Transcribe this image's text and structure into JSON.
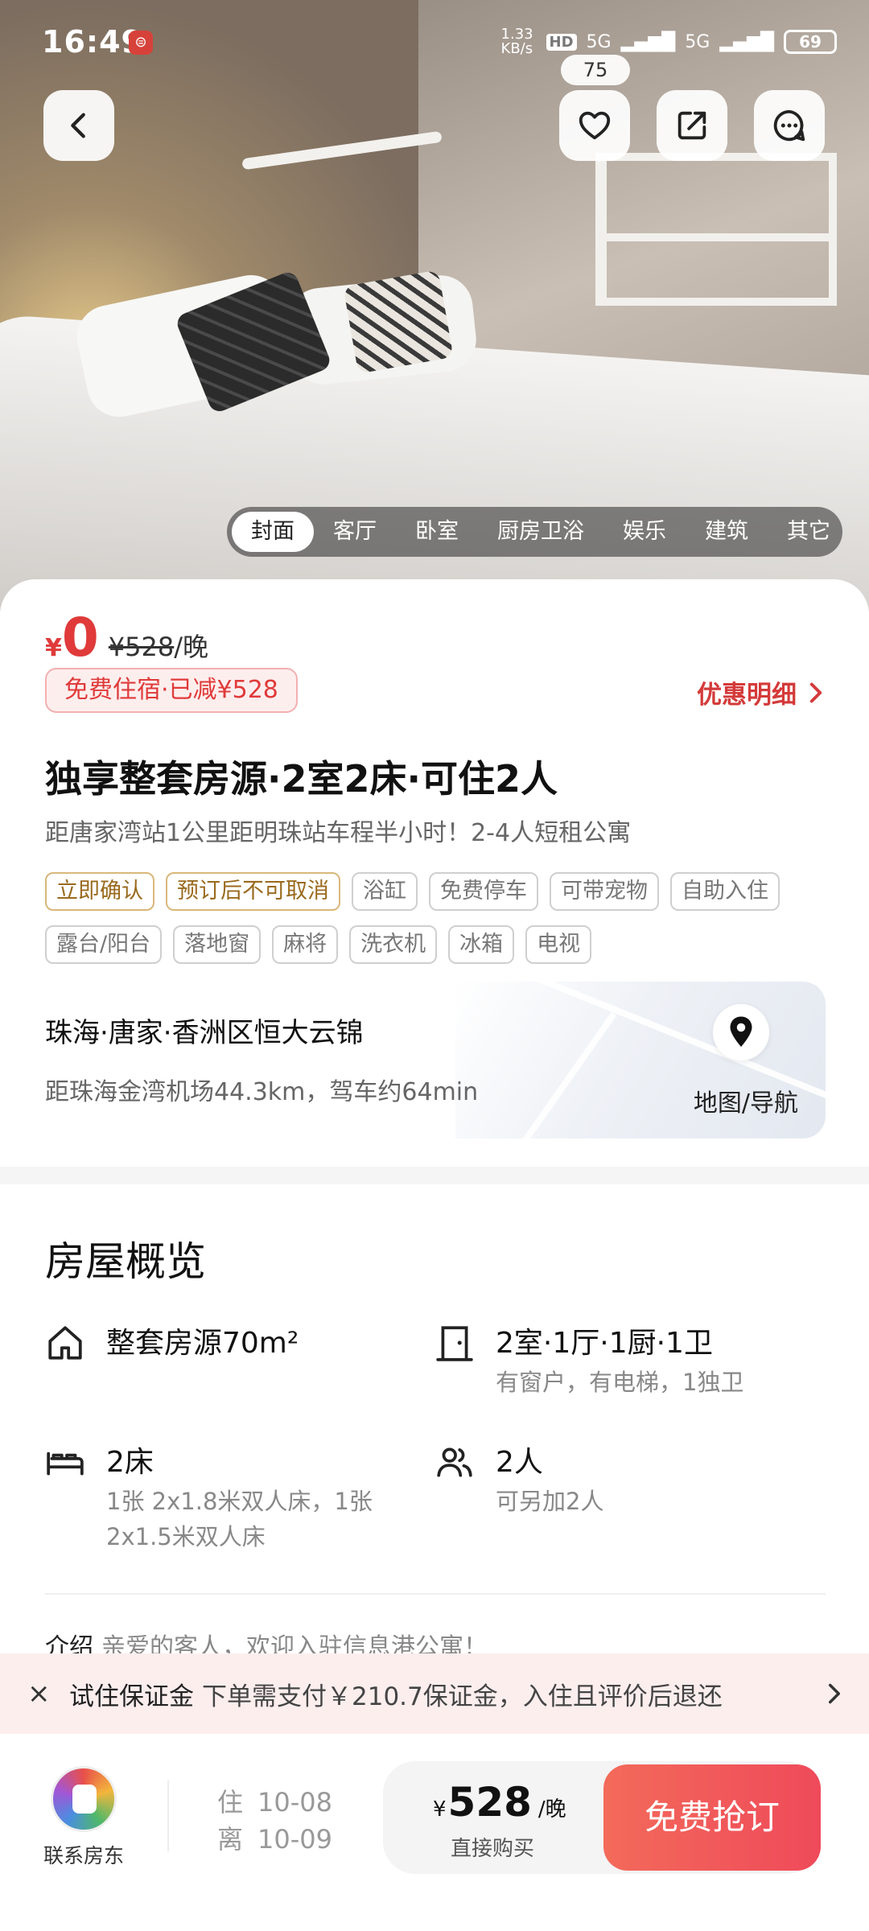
{
  "status_bar": {
    "time": "16:49",
    "net_speed": "1.33 KB/s",
    "hd": "HD",
    "signal1": "5G",
    "signal2": "5G",
    "battery": "69"
  },
  "header": {
    "favorite_count": "75",
    "icons": [
      "back-icon",
      "heart-icon",
      "share-icon",
      "message-icon"
    ]
  },
  "photo_tabs": [
    "封面",
    "客厅",
    "卧室",
    "厨房卫浴",
    "娱乐",
    "建筑",
    "其它"
  ],
  "photo_tab_active": 0,
  "price": {
    "currency": "¥",
    "current": "0",
    "original": "¥528",
    "per_night": "/晚",
    "promo": "免费住宿·已减¥528",
    "detail_link": "优惠明细"
  },
  "listing": {
    "title": "独享整套房源·2室2床·可住2人",
    "subtitle": "距唐家湾站1公里距明珠站车程半小时！2-4人短租公寓",
    "tags_highlight": [
      "立即确认",
      "预订后不可取消"
    ],
    "tags": [
      "浴缸",
      "免费停车",
      "可带宠物",
      "自助入住",
      "露台/阳台",
      "落地窗",
      "麻将",
      "洗衣机",
      "冰箱",
      "电视"
    ]
  },
  "location": {
    "name": "珠海·唐家·香洲区恒大云锦",
    "distance": "距珠海金湾机场44.3km，驾车约64min",
    "map_label": "地图/导航"
  },
  "overview": {
    "title": "房屋概览",
    "items": [
      {
        "main": "整套房源70m²",
        "sub": ""
      },
      {
        "main": "2室·1厅·1厨·1卫",
        "sub": "有窗户，有电梯，1独卫"
      },
      {
        "main": "2床",
        "sub": "1张 2x1.8米双人床，1张 2x1.5米双人床"
      },
      {
        "main": "2人",
        "sub": "可另加2人"
      }
    ],
    "intro_label": "介绍",
    "intro_text": "亲爱的客人，欢迎入驻信息港公寓！"
  },
  "deposit": {
    "close": "×",
    "title": "试住保证金",
    "text": "下单需支付￥210.7保证金，入住且评价后退还"
  },
  "bottom_bar": {
    "host_label": "联系房东",
    "checkin_label": "住",
    "checkin_date": "10-08",
    "checkout_label": "离",
    "checkout_date": "10-09",
    "buy_currency": "¥",
    "buy_price": "528",
    "buy_unit": "/晚",
    "buy_label": "直接购买",
    "book_button": "免费抢订"
  }
}
